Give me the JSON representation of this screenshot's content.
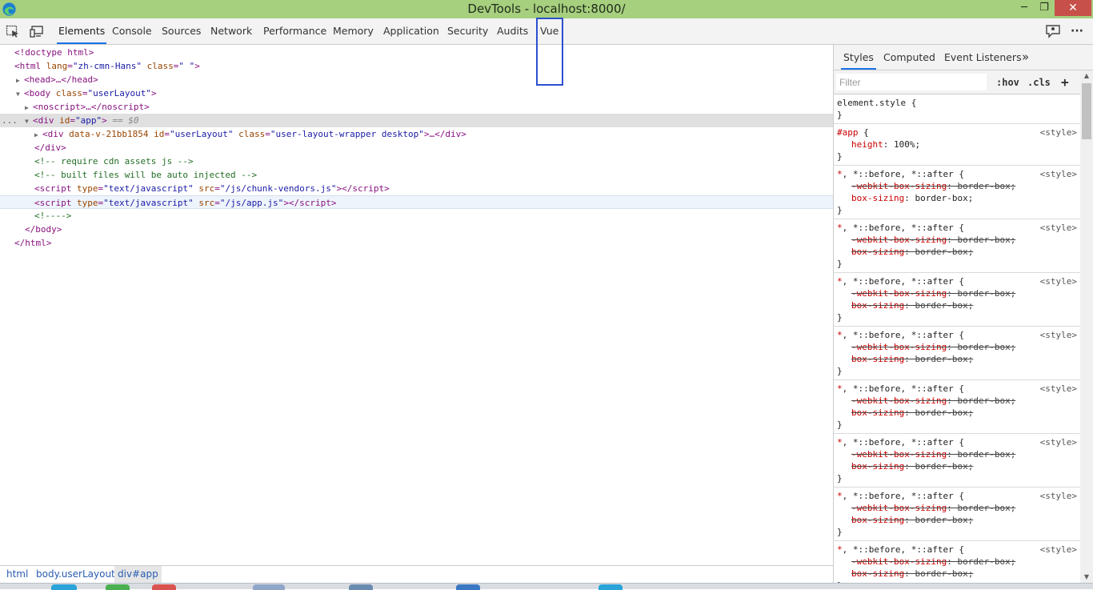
{
  "window": {
    "title": "DevTools - localhost:8000/",
    "min_label": "─",
    "max_label": "❐",
    "close_label": "✕"
  },
  "toolbar": {
    "tabs": [
      {
        "label": "Elements",
        "active": true
      },
      {
        "label": "Console"
      },
      {
        "label": "Sources"
      },
      {
        "label": "Network"
      },
      {
        "label": "Performance"
      },
      {
        "label": "Memory"
      },
      {
        "label": "Application"
      },
      {
        "label": "Security"
      },
      {
        "label": "Audits"
      },
      {
        "label": "Vue"
      }
    ],
    "more_label": "···",
    "icons": [
      "inspect-element-icon",
      "device-toolbar-icon",
      "feedback-icon",
      "more-options-icon"
    ]
  },
  "dom": {
    "doctype": "<!doctype html>",
    "html_open_tag": "html",
    "html_lang_attr": "lang",
    "html_lang_val": "\"zh-cmn-Hans\"",
    "html_class_attr": "class",
    "html_class_val": "\" \"",
    "head": "<head>…</head>",
    "body_tag": "body",
    "body_class_attr": "class",
    "body_class_val": "\"userLayout\"",
    "noscript": "<noscript>…</noscript>",
    "div_app_tag": "div",
    "div_app_attr": "id",
    "div_app_val": "\"app\"",
    "div_app_eq": "== $0",
    "inner_div_tag": "div",
    "inner_div_attr1": "data-v-21bb1854",
    "inner_div_attr2": "id",
    "inner_div_val2": "\"userLayout\"",
    "inner_div_attr3": "class",
    "inner_div_val3": "\"user-layout-wrapper desktop\"",
    "inner_div_close": ">…</div>",
    "div_close": "</div>",
    "comment1": "<!-- require cdn assets js -->",
    "comment2": "<!-- built files will be auto injected -->",
    "script1_type_attr": "type",
    "script1_type_val": "\"text/javascript\"",
    "script1_src_attr": "src",
    "script1_src_val": "\"/js/chunk-vendors.js\"",
    "script2_type_attr": "type",
    "script2_type_val": "\"text/javascript\"",
    "script2_src_attr": "src",
    "script2_src_val": "\"/js/app.js\"",
    "comment3": "<!---->",
    "body_close": "</body>",
    "html_close": "</html>",
    "ellipsis": "..."
  },
  "breadcrumb": {
    "items": [
      "html",
      "body.userLayout",
      "div#app"
    ]
  },
  "styles_pane": {
    "tabs": [
      "Styles",
      "Computed",
      "Event Listeners"
    ],
    "overflow_label": "»",
    "filter_placeholder": "Filter",
    "hov_label": ":hov",
    "cls_label": ".cls",
    "add_label": "+",
    "element_style": "element.style {",
    "close_brace": "}",
    "app_selector": "#app",
    "app_open": " {",
    "app_prop": "height",
    "app_value": ": 100%;",
    "origin": "<style>",
    "universal_star": "*",
    "universal_rest": ", *::before, *::after {",
    "webkit_prop": "-webkit-box-sizing",
    "box_prop": "box-sizing",
    "prop_value": ": border-box;"
  },
  "colors": {
    "titlebar": "#a6cf7e",
    "close_button": "#c7504a",
    "accent": "#1a73e8",
    "highlight_box": "#2d4fd0"
  }
}
